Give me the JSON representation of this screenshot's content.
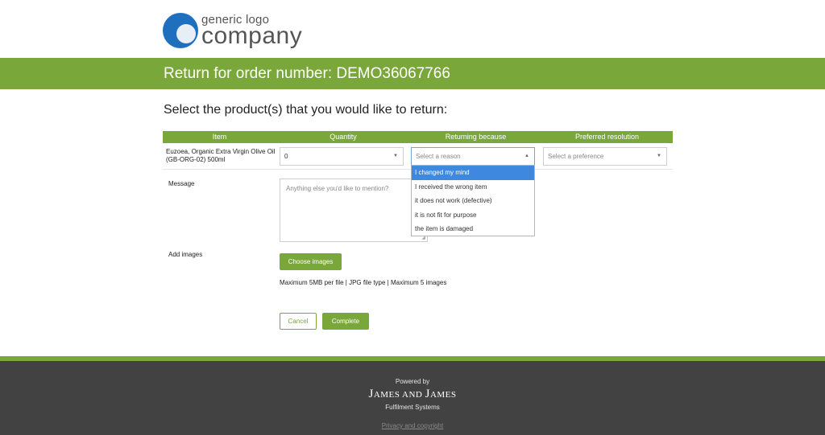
{
  "logo": {
    "small_text": "generic logo",
    "big_text": "company"
  },
  "header": {
    "title": "Return for order number: DEMO36067766"
  },
  "section": {
    "title": "Select the product(s) that you would like to return:"
  },
  "table": {
    "headers": {
      "item": "Item",
      "quantity": "Quantity",
      "reason": "Returning because",
      "preference": "Preferred resolution"
    },
    "row": {
      "item_name": "Euzoea, Organic Extra Virgin Olive Oil (GB-ORG-02) 500ml",
      "quantity_value": "0",
      "reason_placeholder": "Select a reason",
      "preference_placeholder": "Select a preference"
    }
  },
  "reason_options": [
    "I changed my mind",
    "I received the wrong item",
    "it does not work (defective)",
    "it is not fit for purpose",
    "the item is damaged"
  ],
  "form": {
    "message_label": "Message",
    "message_placeholder": "Anything else you'd like to mention?",
    "images_label": "Add images",
    "choose_images_label": "Choose images",
    "images_hint": "Maximum 5MB per file | JPG file type | Maximum 5 images",
    "cancel_label": "Cancel",
    "complete_label": "Complete"
  },
  "footer": {
    "powered_by": "Powered by",
    "brand_part1": "J",
    "brand_part2": "AMES AND ",
    "brand_part3": "J",
    "brand_part4": "AMES",
    "tagline": "Fulfilment Systems",
    "privacy_link": "Privacy and copyright"
  },
  "colors": {
    "accent": "#7aa73a",
    "highlight": "#3e88e0",
    "footer_bg": "#424242",
    "logo_blue": "#1f6fbf"
  }
}
